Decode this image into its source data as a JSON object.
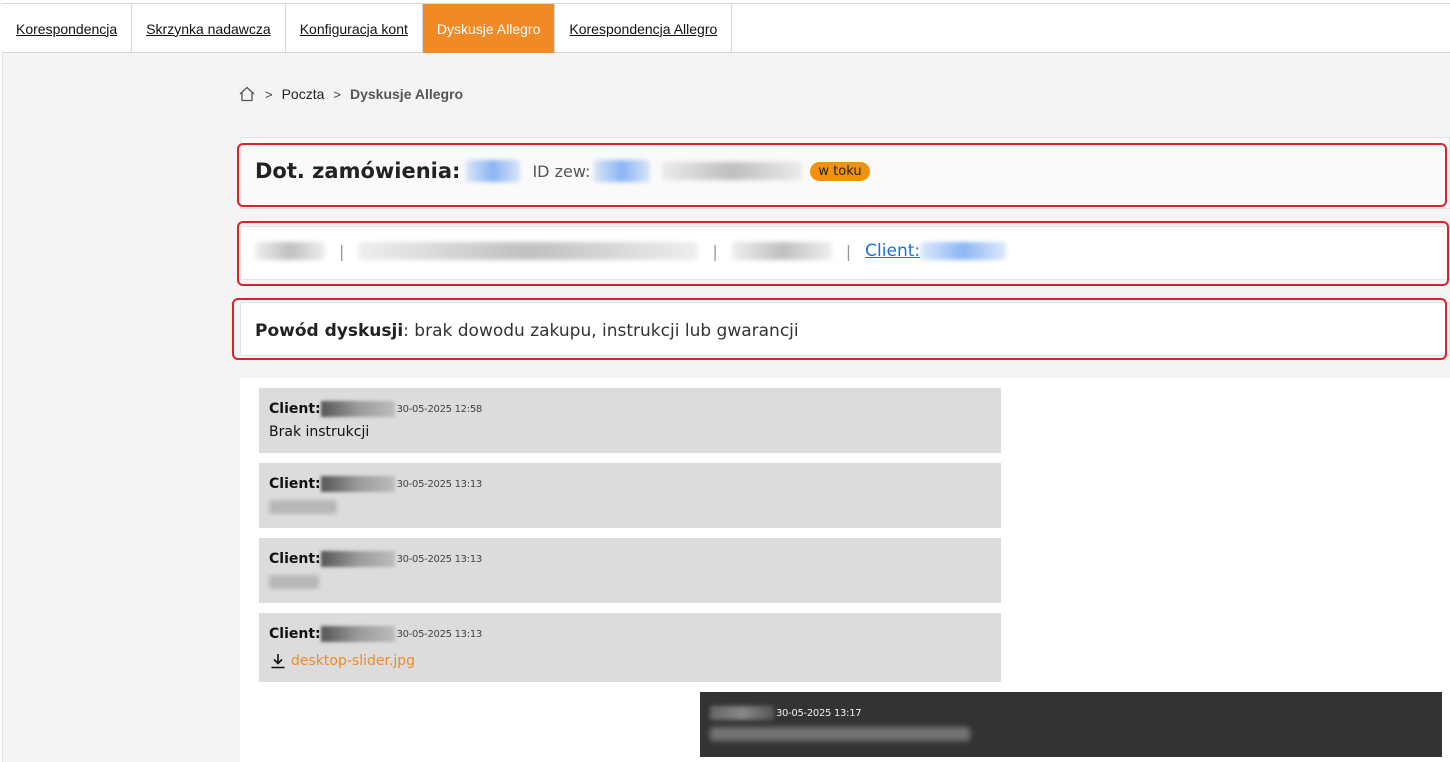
{
  "tabs": [
    {
      "label": "Korespondencja",
      "active": false
    },
    {
      "label": "Skrzynka nadawcza",
      "active": false
    },
    {
      "label": "Konfiguracja kont",
      "active": false
    },
    {
      "label": "Dyskusje Allegro",
      "active": true
    },
    {
      "label": "Korespondencja Allegro",
      "active": false
    }
  ],
  "breadcrumb": {
    "home_icon": "home-icon",
    "separator": ">",
    "items": [
      "Poczta",
      "Dyskusje Allegro"
    ]
  },
  "order": {
    "title": "Dot. zamówienia:",
    "id_label": "ID zew:",
    "status": "w toku"
  },
  "contact": {
    "client_label": "Client:"
  },
  "reason": {
    "label": "Powód dyskusji",
    "text": ": brak dowodu zakupu, instrukcji lub gwarancji"
  },
  "messages": [
    {
      "author": "Client:",
      "date": "30-05-2025 12:58",
      "body": "Brak instrukcji"
    },
    {
      "author": "Client:",
      "date": "30-05-2025 13:13",
      "body": ""
    },
    {
      "author": "Client:",
      "date": "30-05-2025 13:13",
      "body": ""
    },
    {
      "author": "Client:",
      "date": "30-05-2025 13:13",
      "attachment": "desktop-slider.jpg"
    }
  ],
  "reply": {
    "date": "30-05-2025 13:17"
  },
  "colors": {
    "accent": "#f08a24",
    "highlight_outline": "#d8232a",
    "status_badge": "#f0920e",
    "link": "#1a6fd8",
    "reply_bg": "#333333"
  }
}
